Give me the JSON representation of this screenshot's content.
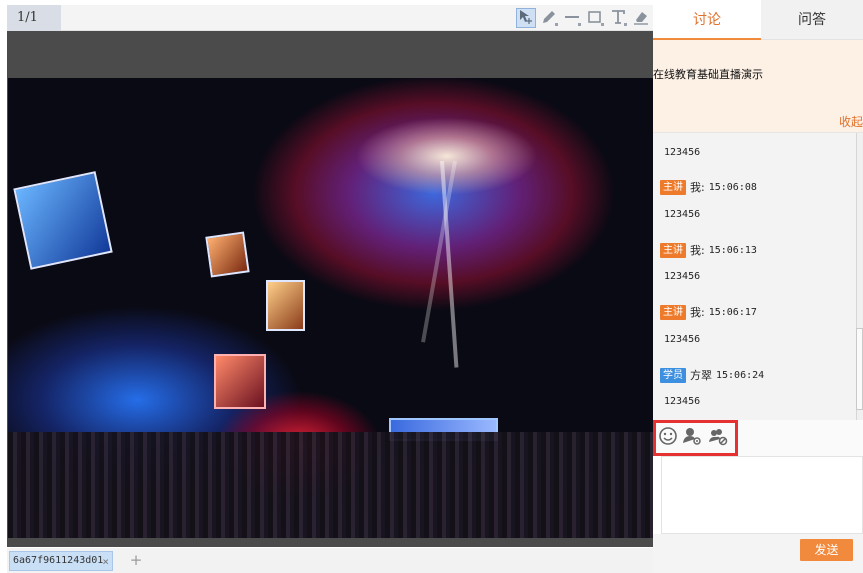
{
  "whiteboard": {
    "page_indicator": "1/1",
    "tools": [
      {
        "icon": "select-move-icon",
        "active": true
      },
      {
        "icon": "pencil-icon",
        "active": false
      },
      {
        "icon": "line-icon",
        "active": false
      },
      {
        "icon": "rectangle-icon",
        "active": false
      },
      {
        "icon": "text-icon",
        "active": false
      },
      {
        "icon": "eraser-icon",
        "active": false
      }
    ],
    "doc_tab": {
      "label": "6a67f9611243d01",
      "close_label": "×"
    },
    "add_tab_label": "+"
  },
  "panel": {
    "tabs": [
      {
        "label": "讨论",
        "active": true
      },
      {
        "label": "问答",
        "active": false
      }
    ],
    "notice": {
      "text": "在线教育基础直播演示",
      "toggle_label": "收起"
    },
    "messages": [
      {
        "text": "123456"
      },
      {
        "role": "主讲",
        "role_type": "host",
        "sender": "我:",
        "time": "15:06:08",
        "text": "123456"
      },
      {
        "role": "主讲",
        "role_type": "host",
        "sender": "我:",
        "time": "15:06:13",
        "text": "123456"
      },
      {
        "role": "主讲",
        "role_type": "host",
        "sender": "我:",
        "time": "15:06:17",
        "text": "123456"
      },
      {
        "role": "学员",
        "role_type": "student",
        "sender": "方翠",
        "time": "15:06:24",
        "text": "123456"
      }
    ],
    "emote_icons": [
      "smiley-icon",
      "user-hide-icon",
      "group-block-icon"
    ],
    "send_label": "发送"
  },
  "colors": {
    "accent": "#ee7b2c",
    "student": "#3d8fe0",
    "highlight": "#e53131"
  }
}
